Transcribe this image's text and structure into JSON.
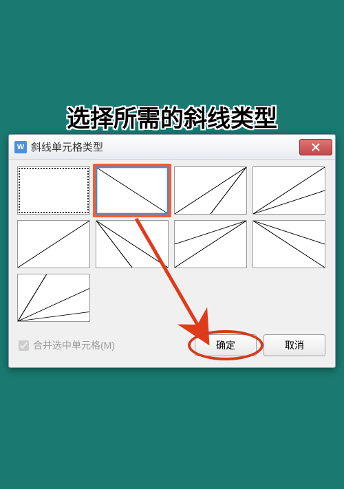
{
  "instruction": "选择所需的斜线类型",
  "dialog": {
    "title": "斜线单元格类型",
    "app_icon_label": "W",
    "checkbox_label": "合并选中单元格(M)",
    "checkbox_checked": true,
    "checkbox_disabled": true,
    "ok_label": "确定",
    "cancel_label": "取消"
  },
  "cells": [
    {
      "id": "none",
      "lines": [],
      "dotted_frame": true
    },
    {
      "id": "diag-tl-br",
      "lines": [
        [
          0,
          0,
          100,
          100
        ]
      ],
      "selected": true,
      "highlighted": true
    },
    {
      "id": "diag-tr-mid-bl",
      "lines": [
        [
          100,
          0,
          50,
          100
        ],
        [
          100,
          0,
          0,
          100
        ]
      ]
    },
    {
      "id": "diag-tr-bl-double-low",
      "lines": [
        [
          0,
          100,
          100,
          50
        ],
        [
          0,
          100,
          100,
          0
        ]
      ]
    },
    {
      "id": "diag-bl-tr",
      "lines": [
        [
          0,
          100,
          100,
          0
        ]
      ]
    },
    {
      "id": "diag-tl-br-double-mid",
      "lines": [
        [
          0,
          0,
          50,
          100
        ],
        [
          0,
          0,
          100,
          100
        ]
      ]
    },
    {
      "id": "diag-tr-bl-double-up",
      "lines": [
        [
          100,
          0,
          0,
          50
        ],
        [
          100,
          0,
          0,
          100
        ]
      ]
    },
    {
      "id": "diag-tl-br-fan",
      "lines": [
        [
          0,
          0,
          100,
          50
        ],
        [
          0,
          0,
          100,
          100
        ]
      ]
    },
    {
      "id": "diag-bl-triple",
      "lines": [
        [
          0,
          100,
          40,
          0
        ],
        [
          0,
          100,
          100,
          30
        ],
        [
          0,
          100,
          100,
          80
        ]
      ]
    }
  ]
}
